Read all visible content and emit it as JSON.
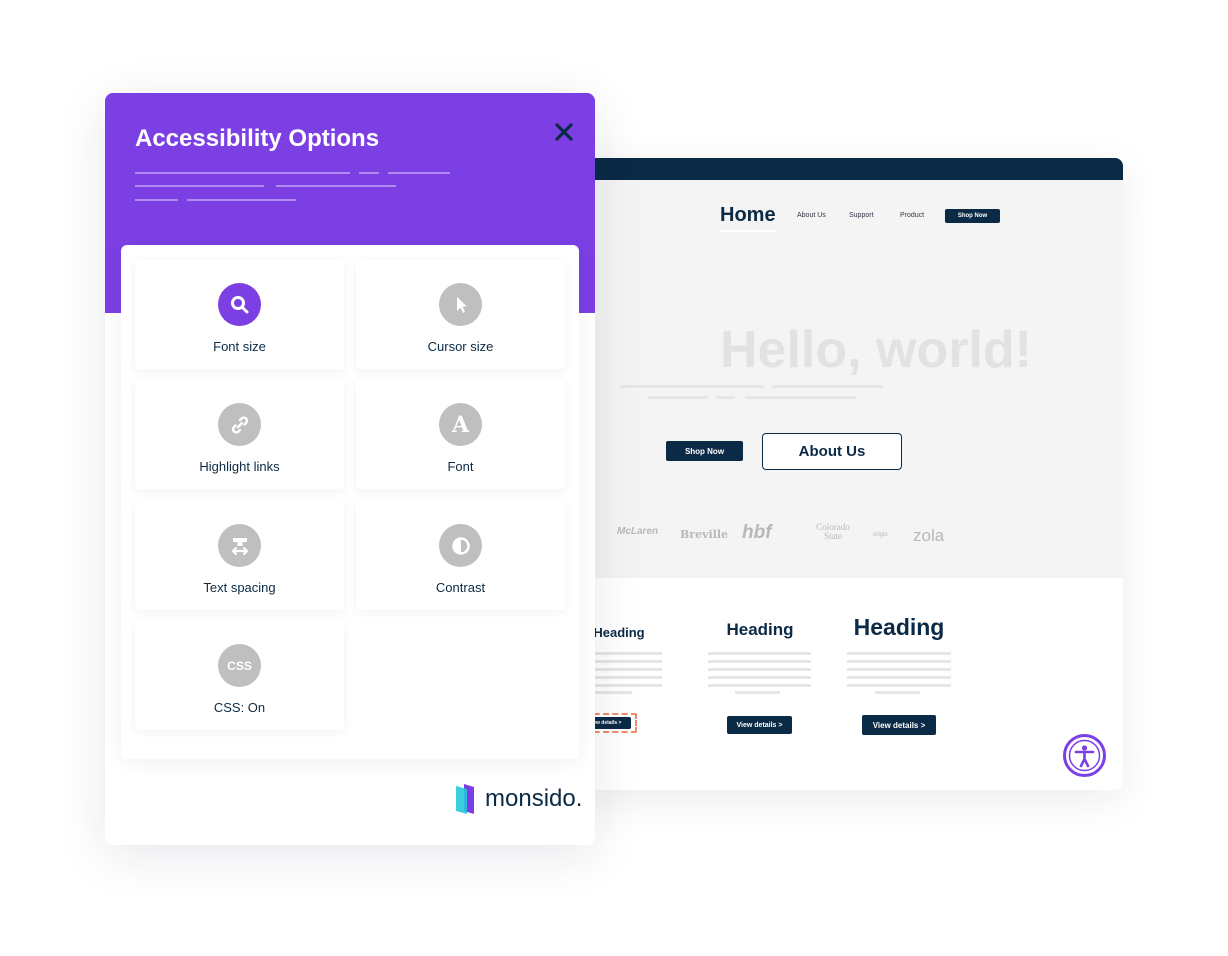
{
  "panel": {
    "title": "Accessibility Options",
    "close_icon": "close-icon",
    "options": [
      {
        "label": "Font size",
        "icon": "magnifier-icon",
        "active": true
      },
      {
        "label": "Cursor size",
        "icon": "cursor-icon",
        "active": false
      },
      {
        "label": "Highlight links",
        "icon": "link-icon",
        "active": false
      },
      {
        "label": "Font",
        "icon": "letter-a-icon",
        "active": false
      },
      {
        "label": "Text spacing",
        "icon": "text-spacing-icon",
        "active": false
      },
      {
        "label": "Contrast",
        "icon": "contrast-icon",
        "active": false
      },
      {
        "label": "CSS: On",
        "icon": "css-icon",
        "icon_text": "CSS",
        "active": false
      }
    ],
    "brand": "monsido."
  },
  "site": {
    "nav": {
      "home": "Home",
      "links": [
        "About Us",
        "Support",
        "Product"
      ],
      "shop": "Shop Now"
    },
    "hero": {
      "title": "Hello, world!",
      "shop": "Shop Now",
      "about": "About Us"
    },
    "logos": [
      "McLaren",
      "Breville",
      "hbf",
      "Colorado State",
      "origin",
      "zola"
    ],
    "cards": [
      {
        "heading": "Heading",
        "button": "View details >"
      },
      {
        "heading": "Heading",
        "button": "View details >"
      },
      {
        "heading": "Heading",
        "button": "View details >"
      }
    ]
  },
  "colors": {
    "accent": "#7b3fe4",
    "navy": "#0b2a45",
    "focus": "#f28b6b"
  }
}
